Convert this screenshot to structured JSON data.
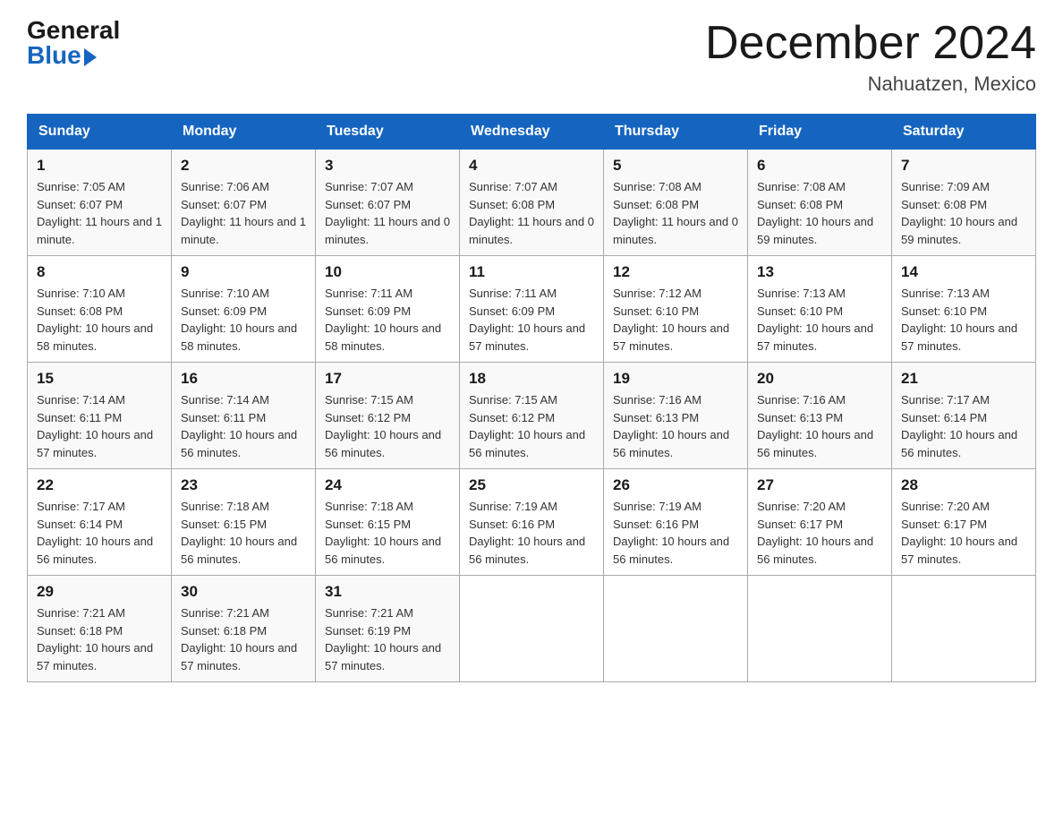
{
  "header": {
    "logo_general": "General",
    "logo_blue": "Blue",
    "month_title": "December 2024",
    "location": "Nahuatzen, Mexico"
  },
  "days_of_week": [
    "Sunday",
    "Monday",
    "Tuesday",
    "Wednesday",
    "Thursday",
    "Friday",
    "Saturday"
  ],
  "weeks": [
    [
      {
        "day": "1",
        "sunrise": "7:05 AM",
        "sunset": "6:07 PM",
        "daylight": "11 hours and 1 minute."
      },
      {
        "day": "2",
        "sunrise": "7:06 AM",
        "sunset": "6:07 PM",
        "daylight": "11 hours and 1 minute."
      },
      {
        "day": "3",
        "sunrise": "7:07 AM",
        "sunset": "6:07 PM",
        "daylight": "11 hours and 0 minutes."
      },
      {
        "day": "4",
        "sunrise": "7:07 AM",
        "sunset": "6:08 PM",
        "daylight": "11 hours and 0 minutes."
      },
      {
        "day": "5",
        "sunrise": "7:08 AM",
        "sunset": "6:08 PM",
        "daylight": "11 hours and 0 minutes."
      },
      {
        "day": "6",
        "sunrise": "7:08 AM",
        "sunset": "6:08 PM",
        "daylight": "10 hours and 59 minutes."
      },
      {
        "day": "7",
        "sunrise": "7:09 AM",
        "sunset": "6:08 PM",
        "daylight": "10 hours and 59 minutes."
      }
    ],
    [
      {
        "day": "8",
        "sunrise": "7:10 AM",
        "sunset": "6:08 PM",
        "daylight": "10 hours and 58 minutes."
      },
      {
        "day": "9",
        "sunrise": "7:10 AM",
        "sunset": "6:09 PM",
        "daylight": "10 hours and 58 minutes."
      },
      {
        "day": "10",
        "sunrise": "7:11 AM",
        "sunset": "6:09 PM",
        "daylight": "10 hours and 58 minutes."
      },
      {
        "day": "11",
        "sunrise": "7:11 AM",
        "sunset": "6:09 PM",
        "daylight": "10 hours and 57 minutes."
      },
      {
        "day": "12",
        "sunrise": "7:12 AM",
        "sunset": "6:10 PM",
        "daylight": "10 hours and 57 minutes."
      },
      {
        "day": "13",
        "sunrise": "7:13 AM",
        "sunset": "6:10 PM",
        "daylight": "10 hours and 57 minutes."
      },
      {
        "day": "14",
        "sunrise": "7:13 AM",
        "sunset": "6:10 PM",
        "daylight": "10 hours and 57 minutes."
      }
    ],
    [
      {
        "day": "15",
        "sunrise": "7:14 AM",
        "sunset": "6:11 PM",
        "daylight": "10 hours and 57 minutes."
      },
      {
        "day": "16",
        "sunrise": "7:14 AM",
        "sunset": "6:11 PM",
        "daylight": "10 hours and 56 minutes."
      },
      {
        "day": "17",
        "sunrise": "7:15 AM",
        "sunset": "6:12 PM",
        "daylight": "10 hours and 56 minutes."
      },
      {
        "day": "18",
        "sunrise": "7:15 AM",
        "sunset": "6:12 PM",
        "daylight": "10 hours and 56 minutes."
      },
      {
        "day": "19",
        "sunrise": "7:16 AM",
        "sunset": "6:13 PM",
        "daylight": "10 hours and 56 minutes."
      },
      {
        "day": "20",
        "sunrise": "7:16 AM",
        "sunset": "6:13 PM",
        "daylight": "10 hours and 56 minutes."
      },
      {
        "day": "21",
        "sunrise": "7:17 AM",
        "sunset": "6:14 PM",
        "daylight": "10 hours and 56 minutes."
      }
    ],
    [
      {
        "day": "22",
        "sunrise": "7:17 AM",
        "sunset": "6:14 PM",
        "daylight": "10 hours and 56 minutes."
      },
      {
        "day": "23",
        "sunrise": "7:18 AM",
        "sunset": "6:15 PM",
        "daylight": "10 hours and 56 minutes."
      },
      {
        "day": "24",
        "sunrise": "7:18 AM",
        "sunset": "6:15 PM",
        "daylight": "10 hours and 56 minutes."
      },
      {
        "day": "25",
        "sunrise": "7:19 AM",
        "sunset": "6:16 PM",
        "daylight": "10 hours and 56 minutes."
      },
      {
        "day": "26",
        "sunrise": "7:19 AM",
        "sunset": "6:16 PM",
        "daylight": "10 hours and 56 minutes."
      },
      {
        "day": "27",
        "sunrise": "7:20 AM",
        "sunset": "6:17 PM",
        "daylight": "10 hours and 56 minutes."
      },
      {
        "day": "28",
        "sunrise": "7:20 AM",
        "sunset": "6:17 PM",
        "daylight": "10 hours and 57 minutes."
      }
    ],
    [
      {
        "day": "29",
        "sunrise": "7:21 AM",
        "sunset": "6:18 PM",
        "daylight": "10 hours and 57 minutes."
      },
      {
        "day": "30",
        "sunrise": "7:21 AM",
        "sunset": "6:18 PM",
        "daylight": "10 hours and 57 minutes."
      },
      {
        "day": "31",
        "sunrise": "7:21 AM",
        "sunset": "6:19 PM",
        "daylight": "10 hours and 57 minutes."
      },
      null,
      null,
      null,
      null
    ]
  ],
  "labels": {
    "sunrise": "Sunrise:",
    "sunset": "Sunset:",
    "daylight": "Daylight:"
  }
}
